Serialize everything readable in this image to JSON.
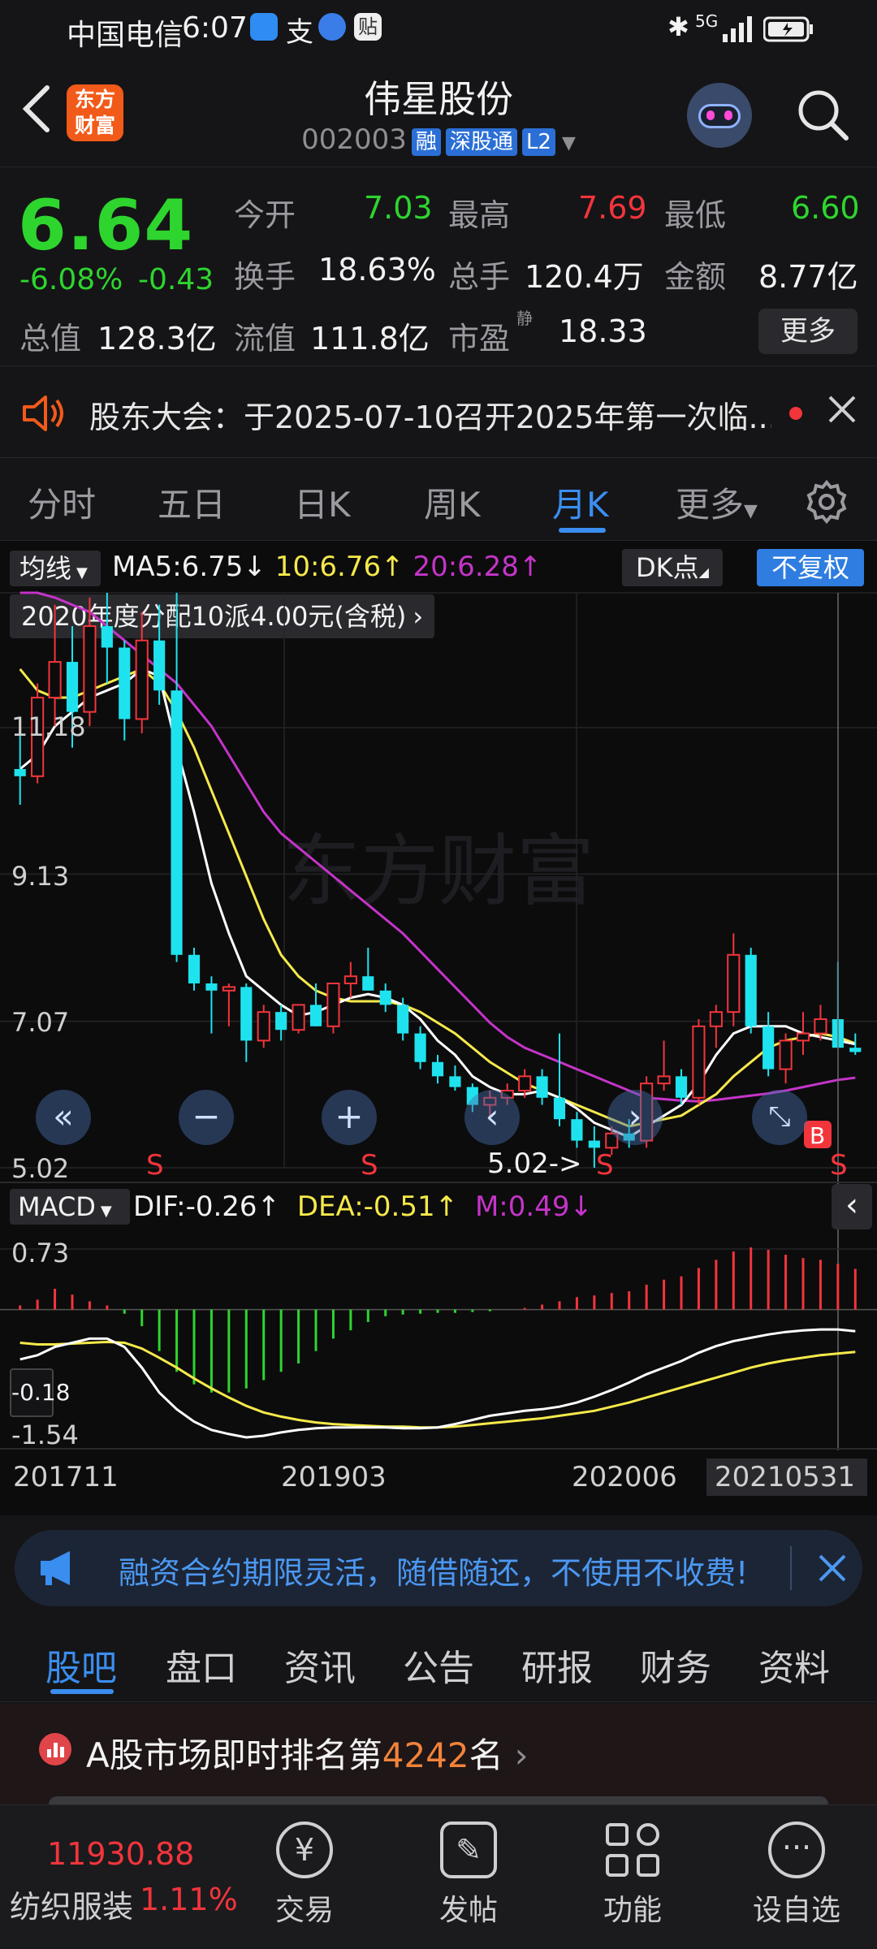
{
  "status_bar": {
    "carrier": "中国电信",
    "time": "6:07",
    "net": "5G"
  },
  "header": {
    "logo_line1": "东方",
    "logo_line2": "财富",
    "title": "伟星股份",
    "code": "002003",
    "badges": [
      "融",
      "深股通",
      "L2"
    ]
  },
  "quote": {
    "price": "6.64",
    "pct": "-6.08%",
    "change": "-0.43",
    "open_label": "今开",
    "open": "7.03",
    "high_label": "最高",
    "high": "7.69",
    "low_label": "最低",
    "low": "6.60",
    "turnover_label": "换手",
    "turnover": "18.63%",
    "volume_label": "总手",
    "volume": "120.4万",
    "amount_label": "金额",
    "amount": "8.77亿",
    "mcap_label": "总值",
    "mcap": "128.3亿",
    "float_label": "流值",
    "float": "111.8亿",
    "pe_label": "市盈",
    "pe_sup": "静",
    "pe": "18.33",
    "more": "更多"
  },
  "notice": {
    "text": "股东大会：于2025-07-10召开2025年第一次临..."
  },
  "tabs": {
    "items": [
      "分时",
      "五日",
      "日K",
      "周K",
      "月K",
      "更多"
    ],
    "active": 4
  },
  "chart": {
    "ma_label": "均线",
    "ma5": "MA5:6.75",
    "ma10": "10:6.76",
    "ma20": "20:6.28",
    "arr_down": "↓",
    "arr_up": "↑",
    "dk": "DK点",
    "fq": "不复权",
    "dividend": "2020年度分配10派4.00元(含税)",
    "watermark": "东方财富",
    "price_ticks": [
      "11.18",
      "9.13",
      "7.07",
      "5.02"
    ],
    "low_mark": "5.02->",
    "macd_label": "MACD",
    "dif": "DIF:-0.26",
    "dea": "DEA:-0.51",
    "m": "M:0.49",
    "macd_ticks": [
      "0.73",
      "-0.18",
      "-1.54"
    ],
    "dates": [
      "201711",
      "201903",
      "202006",
      "20210531"
    ],
    "s_label": "S",
    "b_label": "B"
  },
  "chart_data": {
    "type": "candlestick",
    "interval": "monthly",
    "ylim": [
      5.02,
      11.18
    ],
    "candles": [
      [
        10.6,
        11.2,
        10.1,
        10.5
      ],
      [
        10.5,
        11.8,
        10.4,
        11.6
      ],
      [
        11.6,
        12.9,
        11.2,
        12.1
      ],
      [
        12.1,
        12.6,
        10.9,
        11.4
      ],
      [
        11.4,
        13.0,
        11.2,
        12.6
      ],
      [
        12.6,
        13.2,
        11.8,
        12.3
      ],
      [
        12.3,
        12.4,
        11.0,
        11.3
      ],
      [
        11.3,
        12.8,
        11.1,
        12.4
      ],
      [
        12.4,
        12.9,
        11.5,
        11.7
      ],
      [
        11.7,
        15.0,
        7.9,
        8.0
      ],
      [
        8.0,
        8.1,
        7.5,
        7.6
      ],
      [
        7.6,
        7.7,
        6.9,
        7.5
      ],
      [
        7.5,
        7.6,
        7.0,
        7.55
      ],
      [
        7.55,
        7.6,
        6.5,
        6.8
      ],
      [
        6.8,
        7.3,
        6.7,
        7.2
      ],
      [
        7.2,
        7.3,
        6.8,
        6.95
      ],
      [
        6.95,
        7.3,
        6.9,
        7.3
      ],
      [
        7.3,
        7.6,
        7.0,
        7.0
      ],
      [
        7.0,
        7.6,
        6.9,
        7.6
      ],
      [
        7.6,
        7.9,
        7.4,
        7.7
      ],
      [
        7.7,
        8.1,
        7.5,
        7.5
      ],
      [
        7.5,
        7.6,
        7.2,
        7.3
      ],
      [
        7.3,
        7.4,
        6.8,
        6.9
      ],
      [
        6.9,
        7.0,
        6.4,
        6.5
      ],
      [
        6.5,
        6.6,
        6.2,
        6.3
      ],
      [
        6.3,
        6.45,
        6.1,
        6.15
      ],
      [
        6.15,
        6.2,
        5.8,
        5.9
      ],
      [
        5.9,
        6.1,
        5.7,
        6.0
      ],
      [
        6.0,
        6.2,
        5.9,
        6.1
      ],
      [
        6.1,
        6.4,
        6.0,
        6.3
      ],
      [
        6.3,
        6.4,
        5.9,
        6.0
      ],
      [
        6.0,
        6.9,
        5.6,
        5.7
      ],
      [
        5.7,
        5.8,
        5.3,
        5.4
      ],
      [
        5.4,
        5.6,
        5.02,
        5.3
      ],
      [
        5.3,
        5.6,
        5.2,
        5.5
      ],
      [
        5.5,
        5.7,
        5.3,
        5.4
      ],
      [
        5.4,
        6.3,
        5.3,
        6.2
      ],
      [
        6.2,
        6.8,
        6.1,
        6.3
      ],
      [
        6.3,
        6.4,
        5.9,
        6.0
      ],
      [
        6.0,
        7.1,
        5.9,
        7.0
      ],
      [
        7.0,
        7.3,
        6.7,
        7.2
      ],
      [
        7.2,
        8.3,
        7.0,
        8.0
      ],
      [
        8.0,
        8.1,
        6.9,
        7.0
      ],
      [
        7.0,
        7.2,
        6.3,
        6.4
      ],
      [
        6.4,
        6.9,
        6.2,
        6.8
      ],
      [
        6.8,
        7.2,
        6.6,
        6.9
      ],
      [
        6.9,
        7.3,
        6.8,
        7.1
      ],
      [
        7.1,
        7.9,
        6.8,
        6.7
      ],
      [
        6.7,
        6.9,
        6.6,
        6.64
      ]
    ],
    "ma5": [
      10.6,
      10.8,
      11.2,
      11.4,
      11.6,
      11.7,
      11.8,
      12.0,
      11.9,
      10.9,
      10.0,
      9.0,
      8.3,
      7.7,
      7.5,
      7.3,
      7.15,
      7.2,
      7.3,
      7.4,
      7.45,
      7.4,
      7.3,
      7.1,
      6.8,
      6.6,
      6.3,
      6.15,
      6.05,
      6.05,
      6.1,
      6.0,
      5.85,
      5.65,
      5.55,
      5.45,
      5.6,
      5.75,
      5.9,
      6.2,
      6.6,
      6.9,
      7.0,
      7.0,
      7.0,
      6.9,
      6.85,
      6.8,
      6.75
    ],
    "ma10": [
      12.0,
      11.7,
      11.6,
      11.6,
      11.7,
      11.8,
      11.9,
      12.0,
      11.8,
      11.4,
      10.9,
      10.3,
      9.7,
      9.1,
      8.5,
      8.0,
      7.7,
      7.5,
      7.4,
      7.35,
      7.35,
      7.35,
      7.3,
      7.2,
      7.05,
      6.9,
      6.7,
      6.5,
      6.35,
      6.2,
      6.1,
      6.0,
      5.9,
      5.8,
      5.7,
      5.6,
      5.65,
      5.7,
      5.75,
      5.9,
      6.05,
      6.3,
      6.5,
      6.7,
      6.8,
      6.85,
      6.9,
      6.85,
      6.76
    ],
    "ma20": [
      13.5,
      13.2,
      13.0,
      12.9,
      12.8,
      12.6,
      12.4,
      12.2,
      12.0,
      11.8,
      11.5,
      11.2,
      10.8,
      10.4,
      10.0,
      9.7,
      9.5,
      9.3,
      9.1,
      8.9,
      8.7,
      8.5,
      8.3,
      8.05,
      7.8,
      7.55,
      7.3,
      7.05,
      6.85,
      6.7,
      6.6,
      6.5,
      6.4,
      6.3,
      6.2,
      6.1,
      6.0,
      5.98,
      5.96,
      5.95,
      5.97,
      6.0,
      6.03,
      6.06,
      6.1,
      6.15,
      6.2,
      6.25,
      6.28
    ],
    "macd_hist": [
      0.05,
      0.12,
      0.25,
      0.18,
      0.1,
      0.05,
      -0.05,
      -0.2,
      -0.5,
      -0.75,
      -0.9,
      -1.0,
      -1.0,
      -0.95,
      -0.85,
      -0.75,
      -0.65,
      -0.5,
      -0.35,
      -0.25,
      -0.15,
      -0.08,
      -0.06,
      -0.05,
      -0.04,
      -0.04,
      -0.03,
      -0.02,
      0.0,
      0.02,
      0.06,
      0.1,
      0.15,
      0.17,
      0.2,
      0.22,
      0.3,
      0.36,
      0.4,
      0.5,
      0.6,
      0.7,
      0.75,
      0.72,
      0.66,
      0.62,
      0.6,
      0.55,
      0.49
    ],
    "dif": [
      -0.6,
      -0.55,
      -0.45,
      -0.4,
      -0.35,
      -0.35,
      -0.45,
      -0.7,
      -1.0,
      -1.2,
      -1.35,
      -1.45,
      -1.5,
      -1.54,
      -1.52,
      -1.48,
      -1.45,
      -1.43,
      -1.42,
      -1.42,
      -1.42,
      -1.42,
      -1.43,
      -1.43,
      -1.42,
      -1.38,
      -1.33,
      -1.28,
      -1.25,
      -1.22,
      -1.2,
      -1.17,
      -1.12,
      -1.05,
      -0.97,
      -0.88,
      -0.78,
      -0.7,
      -0.62,
      -0.52,
      -0.44,
      -0.38,
      -0.34,
      -0.3,
      -0.27,
      -0.25,
      -0.24,
      -0.24,
      -0.26
    ],
    "dea": [
      -0.4,
      -0.42,
      -0.42,
      -0.41,
      -0.4,
      -0.39,
      -0.4,
      -0.47,
      -0.58,
      -0.7,
      -0.83,
      -0.95,
      -1.06,
      -1.16,
      -1.24,
      -1.29,
      -1.33,
      -1.36,
      -1.38,
      -1.39,
      -1.4,
      -1.41,
      -1.41,
      -1.42,
      -1.42,
      -1.41,
      -1.39,
      -1.37,
      -1.35,
      -1.33,
      -1.31,
      -1.28,
      -1.25,
      -1.22,
      -1.17,
      -1.12,
      -1.06,
      -1.0,
      -0.94,
      -0.88,
      -0.82,
      -0.76,
      -0.7,
      -0.65,
      -0.61,
      -0.58,
      -0.55,
      -0.53,
      -0.51
    ],
    "macd_range": [
      -1.54,
      0.73
    ]
  },
  "banner": {
    "text": "融资合约期限灵活，随借随还，不使用不收费!"
  },
  "bottom_tabs": {
    "items": [
      "股吧",
      "盘口",
      "资讯",
      "公告",
      "研报",
      "财务",
      "资料"
    ],
    "active": 0
  },
  "rank": {
    "pre": "A股市场即时排名第",
    "num": "4242",
    "post": "名"
  },
  "nav": {
    "index_value": "11930.88",
    "index_name": "纺织服装",
    "index_pct": "1.11%",
    "items": [
      "交易",
      "发帖",
      "功能",
      "设自选"
    ]
  },
  "colors": {
    "up": "#f2353b",
    "down": "#1ee3ee",
    "ma5": "#ffffff",
    "ma10": "#f5e94a",
    "ma20": "#c534c8",
    "accent": "#2f7de0"
  }
}
